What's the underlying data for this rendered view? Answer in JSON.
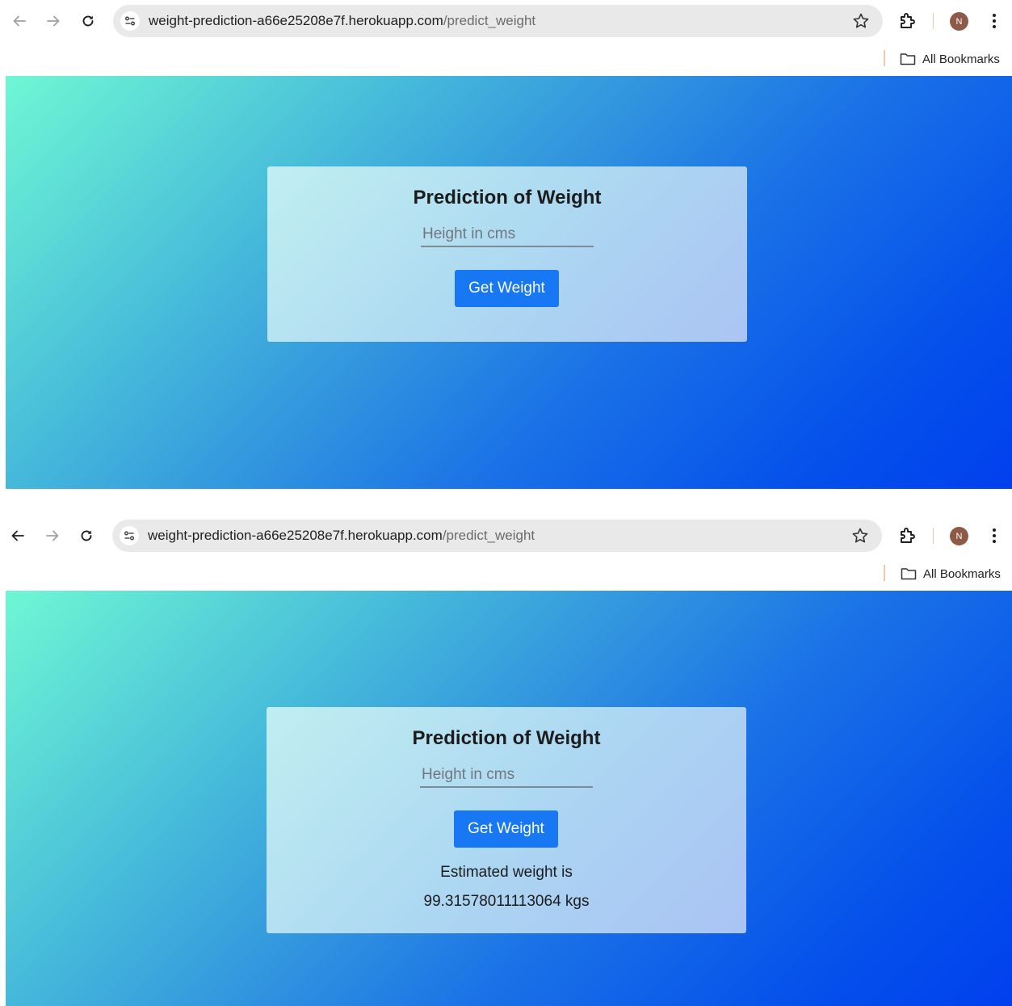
{
  "screens": [
    {
      "browser": {
        "url_host": "weight-prediction-a66e25208e7f.herokuapp.com",
        "url_path": "/predict_weight",
        "bookmarks_label": "All Bookmarks",
        "avatar_initial": "N",
        "back_enabled": false
      },
      "page": {
        "title": "Prediction of Weight",
        "height_placeholder": "Height in cms",
        "button_label": "Get Weight"
      }
    },
    {
      "browser": {
        "url_host": "weight-prediction-a66e25208e7f.herokuapp.com",
        "url_path": "/predict_weight",
        "bookmarks_label": "All Bookmarks",
        "avatar_initial": "N",
        "back_enabled": true
      },
      "page": {
        "title": "Prediction of Weight",
        "height_placeholder": "Height in cms",
        "button_label": "Get Weight",
        "result_label": "Estimated weight is",
        "result_value": "99.31578011113064 kgs"
      }
    }
  ],
  "colors": {
    "button": "#1877f2",
    "gradient_start": "#6ff7d3",
    "gradient_end": "#0040ee",
    "avatar": "#8e5a47"
  },
  "icons": [
    "back-arrow-icon",
    "forward-arrow-icon",
    "reload-icon",
    "site-info-icon",
    "bookmark-star-icon",
    "extensions-icon",
    "kebab-menu-icon",
    "folder-icon"
  ]
}
